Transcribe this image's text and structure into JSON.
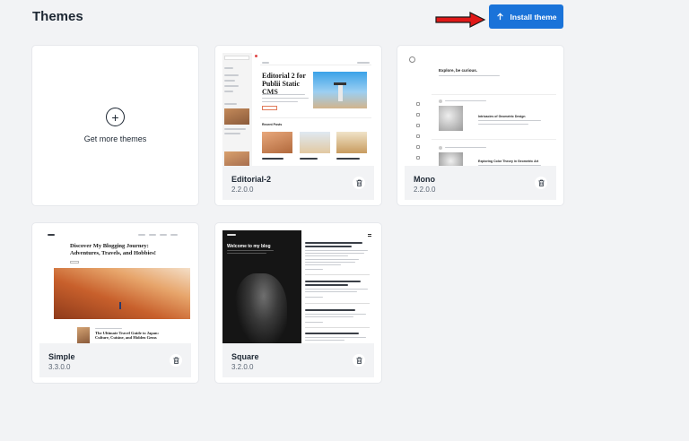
{
  "header": {
    "title": "Themes",
    "install_label": "Install theme"
  },
  "get_more": {
    "label": "Get more themes"
  },
  "themes": [
    {
      "name": "Editorial-2",
      "version": "2.2.0.0",
      "preview": {
        "headline": "Editorial 2 for Publii Static CMS",
        "section": "Recent Posts"
      }
    },
    {
      "name": "Mono",
      "version": "2.2.0.0",
      "preview": {
        "tagline": "Explore, be curious.",
        "post1": "Intricacies of Geometric Design",
        "post2": "Exploring Color Theory in Geometric Art"
      }
    },
    {
      "name": "Simple",
      "version": "3.3.0.0",
      "preview": {
        "headline": "Discover My Blogging Journey: Adventures, Travels, and Hobbies!",
        "post": "The Ultimate Travel Guide to Japan: Culture, Cuisine, and Hidden Gems"
      }
    },
    {
      "name": "Square",
      "version": "3.2.0.0",
      "preview": {
        "headline": "Welcome to my blog"
      }
    }
  ],
  "colors": {
    "accent": "#1a73d9",
    "arrow": "#e01818",
    "background": "#f2f3f5"
  }
}
